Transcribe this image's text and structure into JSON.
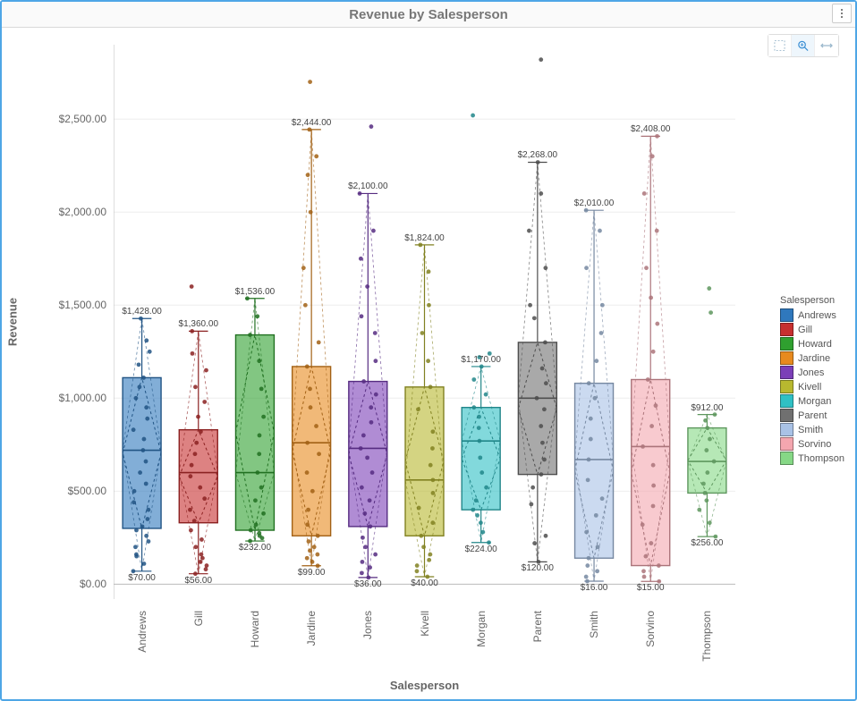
{
  "title": "Revenue by Salesperson",
  "xlabel": "Salesperson",
  "ylabel": "Revenue",
  "legend_title": "Salesperson",
  "y_ticks": [
    {
      "v": 0,
      "label": "$0.00"
    },
    {
      "v": 500,
      "label": "$500.00"
    },
    {
      "v": 1000,
      "label": "$1,000.00"
    },
    {
      "v": 1500,
      "label": "$1,500.00"
    },
    {
      "v": 2000,
      "label": "$2,000.00"
    },
    {
      "v": 2500,
      "label": "$2,500.00"
    }
  ],
  "toolbar": {
    "select_tool": "Select",
    "zoom_tool": "Zoom",
    "pan_tool": "Pan"
  },
  "chart_data": {
    "type": "boxplot",
    "ylim": [
      -80,
      2900
    ],
    "categories": [
      "Andrews",
      "Gill",
      "Howard",
      "Jardine",
      "Jones",
      "Kivell",
      "Morgan",
      "Parent",
      "Smith",
      "Sorvino",
      "Thompson"
    ],
    "series": [
      {
        "name": "Andrews",
        "color": "#2f78bd",
        "min": 70,
        "q1": 300,
        "median": 720,
        "q3": 1110,
        "max": 1428,
        "min_label": "$70.00",
        "max_label": "$1,428.00",
        "points": [
          70,
          110,
          150,
          160,
          200,
          230,
          260,
          290,
          310,
          350,
          400,
          440,
          500,
          540,
          600,
          660,
          720,
          780,
          830,
          890,
          950,
          1000,
          1060,
          1110,
          1180,
          1250,
          1310,
          1428
        ],
        "outliers": []
      },
      {
        "name": "Gill",
        "color": "#c62f2f",
        "min": 56,
        "q1": 330,
        "median": 600,
        "q3": 830,
        "max": 1360,
        "min_label": "$56.00",
        "max_label": "$1,360.00",
        "points": [
          56,
          80,
          100,
          120,
          140,
          160,
          200,
          240,
          290,
          340,
          400,
          460,
          520,
          580,
          640,
          700,
          760,
          820,
          900,
          980,
          1060,
          1150,
          1240,
          1360,
          1600
        ],
        "outliers": [
          1600
        ]
      },
      {
        "name": "Howard",
        "color": "#2fa02f",
        "min": 232,
        "q1": 290,
        "median": 600,
        "q3": 1340,
        "max": 1536,
        "min_label": "$232.00",
        "max_label": "$1,536.00",
        "points": [
          232,
          248,
          260,
          275,
          290,
          320,
          380,
          450,
          520,
          600,
          700,
          800,
          900,
          1050,
          1200,
          1340,
          1440,
          1536
        ],
        "outliers": []
      },
      {
        "name": "Jardine",
        "color": "#e78a1e",
        "min": 99,
        "q1": 260,
        "median": 760,
        "q3": 1170,
        "max": 2444,
        "min_label": "$99.00",
        "max_label": "$2,444.00",
        "points": [
          99,
          120,
          140,
          160,
          180,
          200,
          230,
          260,
          320,
          400,
          500,
          600,
          700,
          760,
          850,
          950,
          1050,
          1170,
          1300,
          1500,
          1700,
          2000,
          2200,
          2300,
          2444,
          2700
        ],
        "outliers": [
          2700
        ]
      },
      {
        "name": "Jones",
        "color": "#7b3fb8",
        "min": 36,
        "q1": 310,
        "median": 730,
        "q3": 1090,
        "max": 2100,
        "min_label": "$36.00",
        "max_label": "$2,100.00",
        "points": [
          36,
          60,
          90,
          120,
          160,
          200,
          250,
          310,
          380,
          450,
          520,
          600,
          680,
          730,
          800,
          870,
          950,
          1020,
          1090,
          1200,
          1350,
          1440,
          1600,
          1750,
          1900,
          2100,
          2460
        ],
        "outliers": [
          2460
        ]
      },
      {
        "name": "Kivell",
        "color": "#b8b82f",
        "min": 40,
        "q1": 260,
        "median": 560,
        "q3": 1060,
        "max": 1824,
        "min_label": "$40.00",
        "max_label": "$1,824.00",
        "points": [
          40,
          70,
          100,
          130,
          160,
          200,
          260,
          330,
          410,
          490,
          560,
          640,
          730,
          820,
          940,
          1060,
          1200,
          1350,
          1500,
          1680,
          1824
        ],
        "outliers": []
      },
      {
        "name": "Morgan",
        "color": "#2fc0c4",
        "min": 224,
        "q1": 400,
        "median": 770,
        "q3": 950,
        "max": 1170,
        "min_label": "$224.00",
        "max_label": "$1,170.00",
        "points": [
          224,
          280,
          330,
          370,
          400,
          450,
          520,
          600,
          680,
          770,
          840,
          900,
          950,
          1020,
          1100,
          1170,
          1220,
          1240,
          2520
        ],
        "outliers": [
          1220,
          1240,
          2520
        ]
      },
      {
        "name": "Parent",
        "color": "#707070",
        "min": 120,
        "q1": 590,
        "median": 1000,
        "q3": 1300,
        "max": 2268,
        "min_label": "$120.00",
        "max_label": "$2,268.00",
        "points": [
          120,
          220,
          260,
          430,
          520,
          590,
          670,
          760,
          850,
          940,
          1000,
          1080,
          1160,
          1300,
          1430,
          1500,
          1700,
          1900,
          2100,
          2268,
          2820
        ],
        "outliers": [
          2820
        ]
      },
      {
        "name": "Smith",
        "color": "#a9c2e6",
        "min": 16,
        "q1": 140,
        "median": 670,
        "q3": 1080,
        "max": 2010,
        "min_label": "$16.00",
        "max_label": "$2,010.00",
        "points": [
          16,
          40,
          70,
          100,
          140,
          200,
          280,
          370,
          460,
          560,
          670,
          780,
          890,
          1000,
          1080,
          1200,
          1350,
          1500,
          1700,
          1900,
          2010
        ],
        "outliers": []
      },
      {
        "name": "Sorvino",
        "color": "#f4a6af",
        "min": 15,
        "q1": 100,
        "median": 740,
        "q3": 1100,
        "max": 2408,
        "min_label": "$15.00",
        "max_label": "$2,408.00",
        "points": [
          15,
          40,
          70,
          100,
          150,
          220,
          320,
          420,
          530,
          640,
          740,
          850,
          960,
          1100,
          1250,
          1400,
          1540,
          1700,
          1900,
          2100,
          2300,
          2408
        ],
        "outliers": []
      },
      {
        "name": "Thompson",
        "color": "#86d886",
        "min": 256,
        "q1": 490,
        "median": 660,
        "q3": 840,
        "max": 912,
        "min_label": "$256.00",
        "max_label": "$912.00",
        "points": [
          256,
          330,
          400,
          450,
          490,
          540,
          600,
          660,
          720,
          780,
          840,
          880,
          912,
          1460,
          1590
        ],
        "outliers": [
          1460,
          1590
        ]
      }
    ]
  }
}
